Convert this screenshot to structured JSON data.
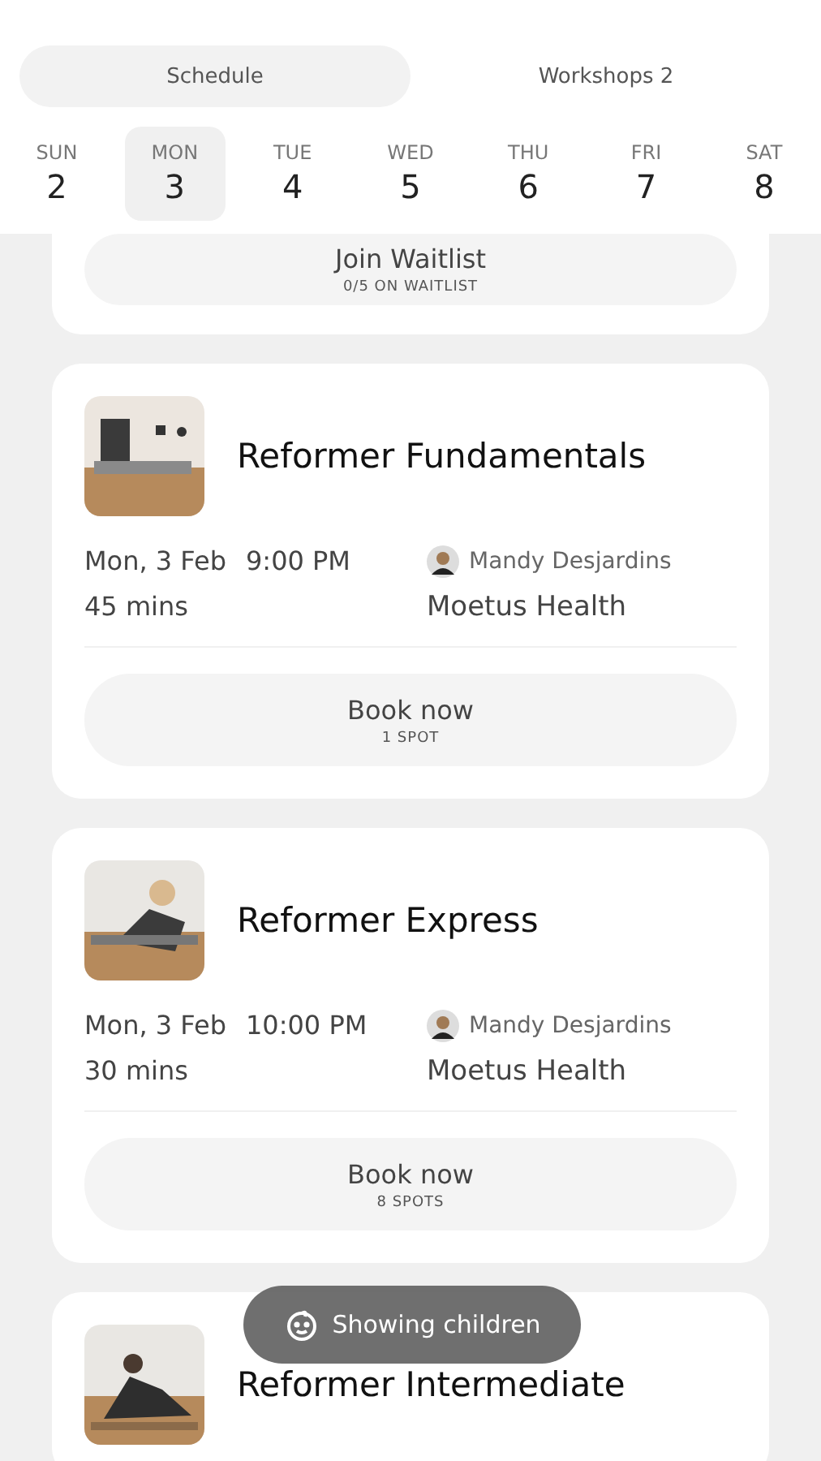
{
  "tabs": [
    {
      "label": "Schedule",
      "selected": true
    },
    {
      "label": "Workshops",
      "badge": "2",
      "selected": false
    }
  ],
  "days": [
    {
      "weekday": "SUN",
      "date": "2",
      "selected": false
    },
    {
      "weekday": "MON",
      "date": "3",
      "selected": true
    },
    {
      "weekday": "TUE",
      "date": "4",
      "selected": false
    },
    {
      "weekday": "WED",
      "date": "5",
      "selected": false
    },
    {
      "weekday": "THU",
      "date": "6",
      "selected": false
    },
    {
      "weekday": "FRI",
      "date": "7",
      "selected": false
    },
    {
      "weekday": "SAT",
      "date": "8",
      "selected": false
    }
  ],
  "classes": [
    {
      "kind": "partial",
      "button": {
        "label": "Join Waitlist",
        "sub": "0/5 ON WAITLIST"
      }
    },
    {
      "kind": "full",
      "title": "Reformer Fundamentals",
      "date": "Mon, 3 Feb",
      "time": "9:00 PM",
      "duration": "45 mins",
      "instructor": "Mandy Desjardins",
      "location": "Moetus Health",
      "button": {
        "label": "Book now",
        "sub": "1 SPOT"
      }
    },
    {
      "kind": "full",
      "title": "Reformer Express",
      "date": "Mon, 3 Feb",
      "time": "10:00 PM",
      "duration": "30 mins",
      "instructor": "Mandy Desjardins",
      "location": "Moetus Health",
      "button": {
        "label": "Book now",
        "sub": "8 SPOTS"
      }
    },
    {
      "kind": "cut",
      "title": "Reformer Intermediate"
    }
  ],
  "toast": {
    "label": "Showing children"
  }
}
